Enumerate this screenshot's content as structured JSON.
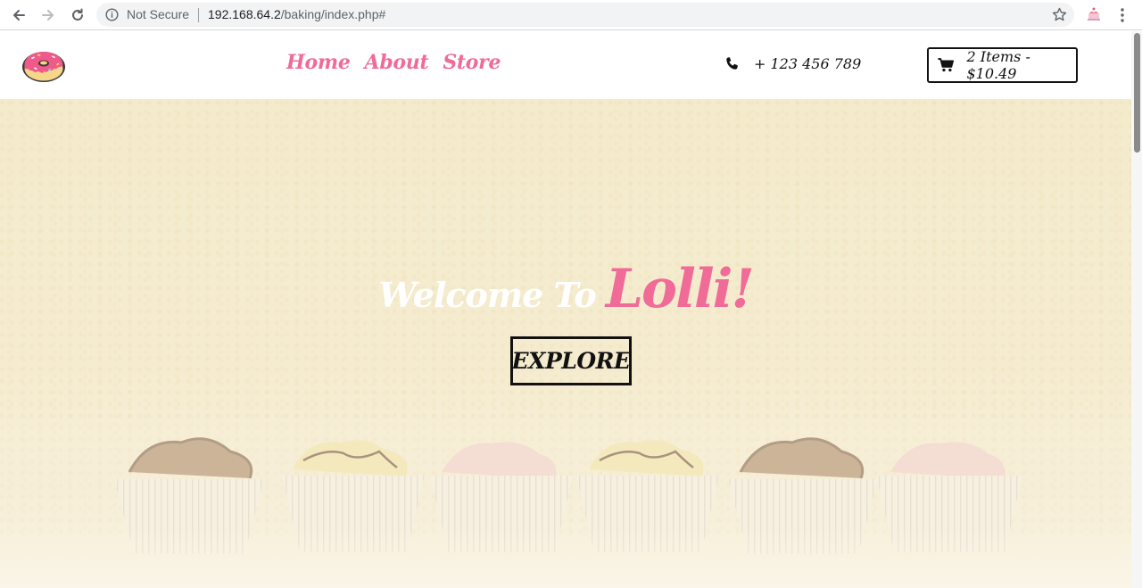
{
  "browser": {
    "security_label": "Not Secure",
    "url_host": "192.168.64.2",
    "url_path": "/baking/index.php#"
  },
  "site": {
    "nav": [
      {
        "label": "Home"
      },
      {
        "label": "About"
      },
      {
        "label": "Store"
      }
    ],
    "phone": "+ 123 456 789",
    "cart": "2 Items - $10.49"
  },
  "hero": {
    "welcome": "Welcome To",
    "brand": "Lolli!",
    "explore_label": "EXPLORE"
  },
  "colors": {
    "brand_pink": "#f06b97",
    "hero_cream": "#f4ebcc",
    "dark": "#111111"
  }
}
